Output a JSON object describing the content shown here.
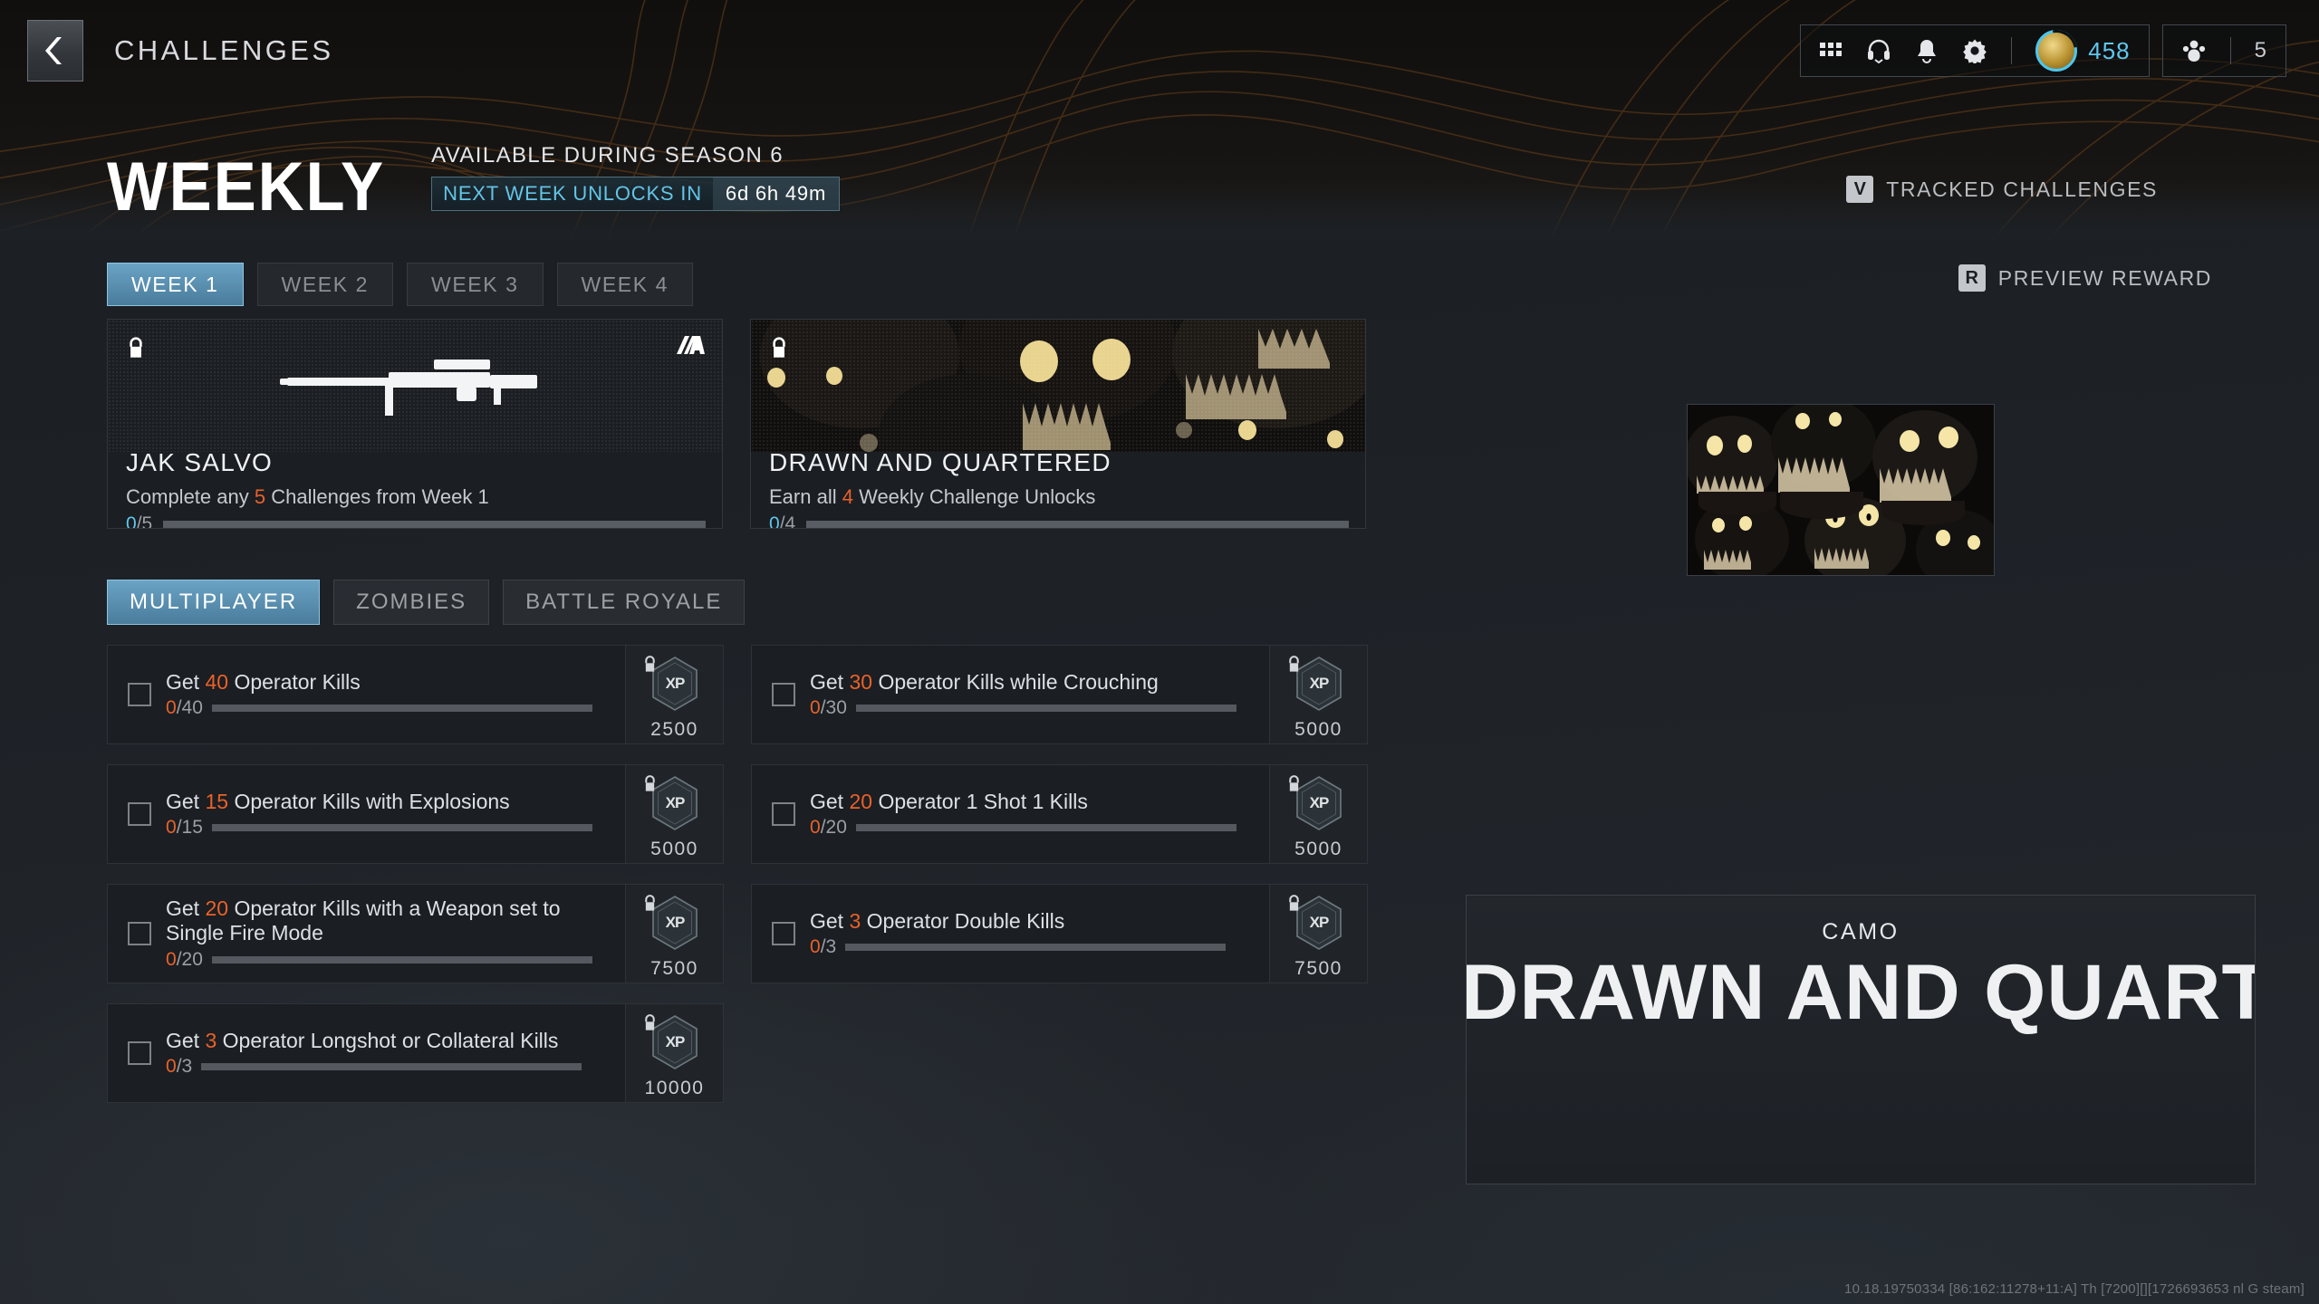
{
  "header": {
    "back_icon": "chevron-left-icon",
    "title": "CHALLENGES",
    "icons": [
      "grid-icon",
      "headphones-icon",
      "bell-icon",
      "gear-icon"
    ],
    "xp_count": "458",
    "squad_count": "5"
  },
  "weekly": {
    "title": "WEEKLY",
    "season_label": "AVAILABLE DURING SEASON 6",
    "timer_label": "NEXT WEEK UNLOCKS IN",
    "timer_value": "6d 6h 49m"
  },
  "tracked": {
    "key": "V",
    "label": "TRACKED CHALLENGES"
  },
  "preview_reward": {
    "key": "R",
    "label": "PREVIEW REWARD"
  },
  "week_tabs": [
    {
      "label": "WEEK 1",
      "active": true
    },
    {
      "label": "WEEK 2",
      "active": false
    },
    {
      "label": "WEEK 3",
      "active": false
    },
    {
      "label": "WEEK 4",
      "active": false
    }
  ],
  "mode_tabs": [
    {
      "label": "MULTIPLAYER",
      "active": true
    },
    {
      "label": "ZOMBIES",
      "active": false
    },
    {
      "label": "BATTLE ROYALE",
      "active": false
    }
  ],
  "reward_cards": [
    {
      "name": "JAK SALVO",
      "desc_pre": "Complete any ",
      "desc_num": "5",
      "desc_post": " Challenges from Week 1",
      "progress_current": "0",
      "progress_total": "5",
      "progress_percent": 0,
      "locked": true,
      "art": "weapon-silhouette",
      "corner_icon": "attachment-icon"
    },
    {
      "name": "DRAWN AND QUARTERED",
      "desc_pre": "Earn all ",
      "desc_num": "4",
      "desc_post": " Weekly Challenge Unlocks",
      "progress_current": "0",
      "progress_total": "4",
      "progress_percent": 0,
      "locked": true,
      "art": "camo-creature",
      "corner_icon": ""
    }
  ],
  "challenges_left": [
    {
      "title_pre": "Get ",
      "title_num": "40",
      "title_post": " Operator Kills",
      "current": "0",
      "total": "40",
      "percent": 0,
      "xp": "2500",
      "locked": true
    },
    {
      "title_pre": "Get ",
      "title_num": "15",
      "title_post": " Operator Kills with Explosions",
      "current": "0",
      "total": "15",
      "percent": 0,
      "xp": "5000",
      "locked": true
    },
    {
      "title_pre": "Get ",
      "title_num": "20",
      "title_post": " Operator Kills with a Weapon set to Single Fire Mode",
      "current": "0",
      "total": "20",
      "percent": 0,
      "xp": "7500",
      "locked": true
    },
    {
      "title_pre": "Get ",
      "title_num": "3",
      "title_post": " Operator Longshot or Collateral Kills",
      "current": "0",
      "total": "3",
      "percent": 0,
      "xp": "10000",
      "locked": true
    }
  ],
  "challenges_right": [
    {
      "title_pre": "Get ",
      "title_num": "30",
      "title_post": " Operator Kills while Crouching",
      "current": "0",
      "total": "30",
      "percent": 0,
      "xp": "5000",
      "locked": true
    },
    {
      "title_pre": "Get ",
      "title_num": "20",
      "title_post": " Operator 1 Shot 1 Kills",
      "current": "0",
      "total": "20",
      "percent": 0,
      "xp": "5000",
      "locked": true
    },
    {
      "title_pre": "Get ",
      "title_num": "3",
      "title_post": " Operator Double Kills",
      "current": "0",
      "total": "3",
      "percent": 0,
      "xp": "7500",
      "locked": true
    }
  ],
  "camo_preview": {
    "kicker": "CAMO",
    "name": "DRAWN AND QUARTERED",
    "name_visible": "AWN AND QUARTERED"
  },
  "build_string": "10.18.19750334 [86:162:11278+11:A] Th [7200][][1726693653 nl G steam]",
  "colors": {
    "accent_orange": "#e8622a",
    "accent_cyan": "#5ec8ee",
    "tab_active": "#4a7c9c",
    "panel_bg": "#1b1e22"
  }
}
